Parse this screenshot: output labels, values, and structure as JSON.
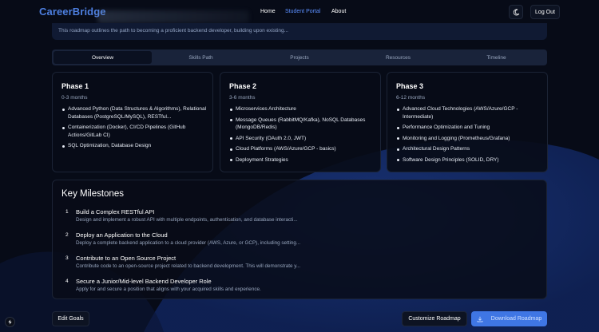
{
  "header": {
    "logo": "CareerBridge",
    "nav": {
      "home": "Home",
      "portal": "Student Portal",
      "about": "About"
    },
    "theme_icon": "moon-icon",
    "logout": "Log Out"
  },
  "intro": {
    "text": "This roadmap outlines the path to becoming a proficient backend developer, building upon existing..."
  },
  "tabs": [
    {
      "label": "Overview",
      "active": true
    },
    {
      "label": "Skills Path",
      "active": false
    },
    {
      "label": "Projects",
      "active": false
    },
    {
      "label": "Resources",
      "active": false
    },
    {
      "label": "Timeline",
      "active": false
    }
  ],
  "phases": [
    {
      "title": "Phase 1",
      "duration": "0-3 months",
      "items": [
        "Advanced Python (Data Structures & Algorithms), Relational Databases (PostgreSQL/MySQL), RESTful...",
        "Containerization (Docker), CI/CD Pipelines (GitHub Actions/GitLab CI)",
        "SQL Optimization, Database Design"
      ]
    },
    {
      "title": "Phase 2",
      "duration": "3-6 months",
      "items": [
        "Microservices Architecture",
        "Message Queues (RabbitMQ/Kafka), NoSQL Databases (MongoDB/Redis)",
        "API Security (OAuth 2.0, JWT)",
        "Cloud Platforms (AWS/Azure/GCP - basics)",
        "Deployment Strategies"
      ]
    },
    {
      "title": "Phase 3",
      "duration": "6-12 months",
      "items": [
        "Advanced Cloud Technologies (AWS/Azure/GCP - Intermediate)",
        "Performance Optimization and Tuning",
        "Monitoring and Logging (Prometheus/Grafana)",
        "Architectural Design Patterns",
        "Software Design Principles (SOLID, DRY)"
      ]
    }
  ],
  "milestones": {
    "title": "Key Milestones",
    "items": [
      {
        "num": "1",
        "title": "Build a Complex RESTful API",
        "desc": "Design and implement a robust API with multiple endpoints, authentication, and database interacti..."
      },
      {
        "num": "2",
        "title": "Deploy an Application to the Cloud",
        "desc": "Deploy a complete backend application to a cloud provider (AWS, Azure, or GCP), including setting..."
      },
      {
        "num": "3",
        "title": "Contribute to an Open Source Project",
        "desc": "Contribute code to an open-source project related to backend development. This will demonstrate y..."
      },
      {
        "num": "4",
        "title": "Secure a Junior/Mid-level Backend Developer Role",
        "desc": "Apply for and secure a position that aligns with your acquired skills and experience."
      }
    ]
  },
  "footer": {
    "edit_goals": "Edit Goals",
    "customize": "Customize Roadmap",
    "download": "Download Roadmap",
    "download_icon": "download-icon",
    "bolt_icon": "bolt-icon"
  },
  "colors": {
    "accent": "#3f76e4",
    "logo": "#4d7fe0",
    "background": "#070b17"
  }
}
